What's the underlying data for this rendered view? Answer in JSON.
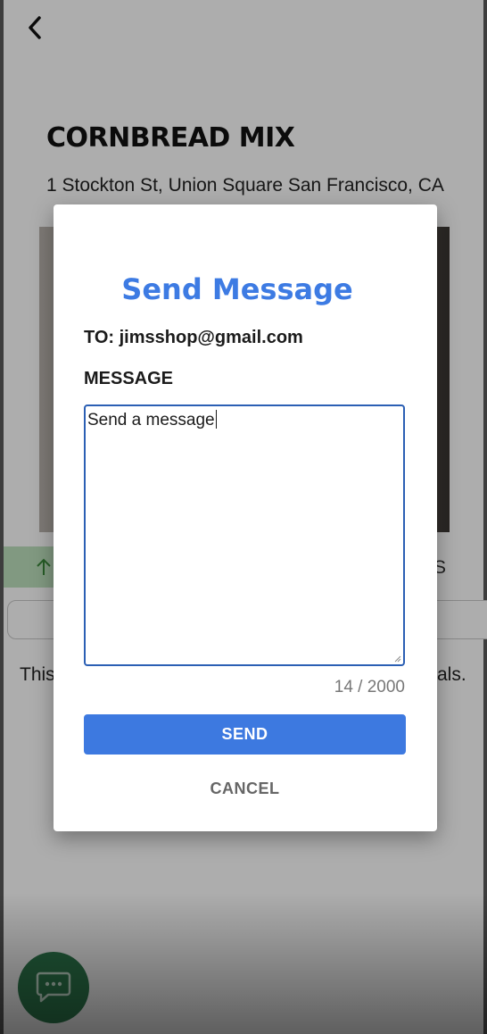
{
  "product": {
    "title": "CORNBREAD MIX",
    "address": "1 Stockton St, Union Square San Francisco, CA"
  },
  "stats": {
    "trailing_letter": "S"
  },
  "description": {
    "left_fragment": "This",
    "right_fragment": "als."
  },
  "dialog": {
    "title": "Send Message",
    "to_line": "TO: jimsshop@gmail.com",
    "message_label": "MESSAGE",
    "message_value": "Send a message",
    "counter": "14 / 2000",
    "send_label": "SEND",
    "cancel_label": "CANCEL"
  },
  "icons": {
    "back": "chevron-left-icon",
    "stat": "arrow-up-icon",
    "fab": "chat-bubble-icon"
  },
  "colors": {
    "accent": "#3d7be3",
    "send_button": "#3d79e0",
    "fab": "#2e7d4f",
    "stat_bar": "#bfe2bf"
  }
}
